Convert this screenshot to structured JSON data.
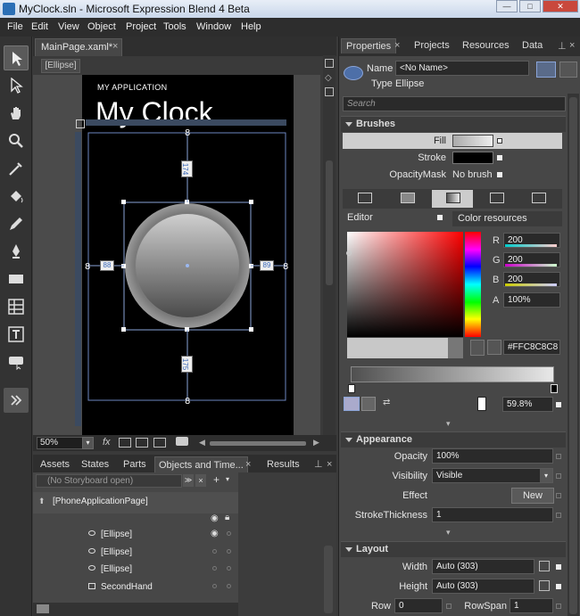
{
  "window": {
    "title": "MyClock.sln - Microsoft Expression Blend 4 Beta",
    "controls": [
      "—",
      "□",
      "✕"
    ]
  },
  "menu": [
    "File",
    "Edit",
    "View",
    "Object",
    "Project",
    "Tools",
    "Window",
    "Help"
  ],
  "document": {
    "tab_label": "MainPage.xaml*",
    "breadcrumb": "[Ellipse]",
    "app_name": "MY APPLICATION",
    "page_title": "My Clock",
    "dims": {
      "top": "174",
      "bottom": "175",
      "left": "88",
      "right": "89"
    },
    "zoom": "50%"
  },
  "lower_tabs": [
    "Assets",
    "States",
    "Parts",
    "Objects and Time...",
    "Results"
  ],
  "objects": {
    "storyboard": "(No Storyboard open)",
    "root": "[PhoneApplicationPage]",
    "items": [
      "[Ellipse]",
      "[Ellipse]",
      "[Ellipse]",
      "SecondHand"
    ]
  },
  "properties": {
    "tabs": [
      "Properties",
      "Projects",
      "Resources",
      "Data"
    ],
    "name_label": "Name",
    "name_value": "<No Name>",
    "type_label": "Type",
    "type_value": "Ellipse",
    "search_placeholder": "Search",
    "brushes_header": "Brushes",
    "fill_label": "Fill",
    "stroke_label": "Stroke",
    "opacitymask_label": "OpacityMask",
    "opacitymask_value": "No brush",
    "editor_label": "Editor",
    "color_resources": "Color resources",
    "r_label": "R",
    "r_value": "200",
    "g_label": "G",
    "g_value": "200",
    "b_label": "B",
    "b_value": "200",
    "a_label": "A",
    "a_value": "100%",
    "hex_value": "#FFC8C8C8",
    "gradient_stop_offset": "59.8%",
    "appearance_header": "Appearance",
    "opacity_label": "Opacity",
    "opacity_value": "100%",
    "visibility_label": "Visibility",
    "visibility_value": "Visible",
    "effect_label": "Effect",
    "new_button": "New",
    "strokethickness_label": "StrokeThickness",
    "strokethickness_value": "1",
    "layout_header": "Layout",
    "width_label": "Width",
    "width_value": "Auto (303)",
    "height_label": "Height",
    "height_value": "Auto (303)",
    "row_label": "Row",
    "row_value": "0",
    "rowspan_label": "RowSpan",
    "rowspan_value": "1"
  },
  "colors": {
    "selected_color": "#c8c8c8",
    "accent": "#2c6fb5"
  }
}
